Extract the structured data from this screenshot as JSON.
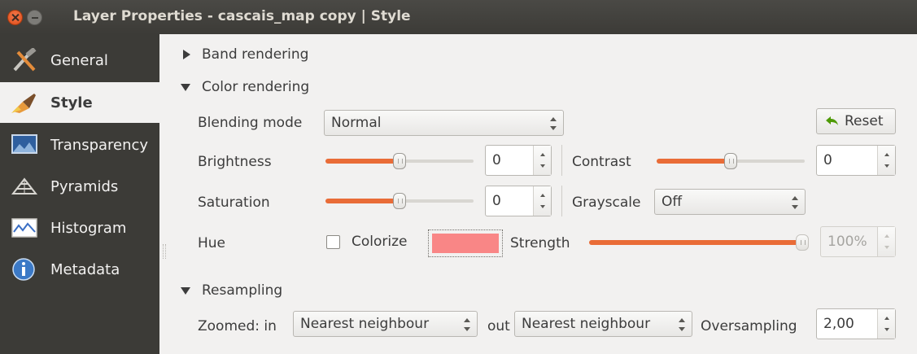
{
  "window": {
    "title": "Layer Properties - cascais_map copy | Style"
  },
  "sidebar": {
    "items": [
      {
        "label": "General",
        "icon": "general-tools-icon",
        "active": false
      },
      {
        "label": "Style",
        "icon": "style-brush-icon",
        "active": true
      },
      {
        "label": "Transparency",
        "icon": "transparency-icon",
        "active": false
      },
      {
        "label": "Pyramids",
        "icon": "pyramids-icon",
        "active": false
      },
      {
        "label": "Histogram",
        "icon": "histogram-icon",
        "active": false
      },
      {
        "label": "Metadata",
        "icon": "metadata-info-icon",
        "active": false
      }
    ]
  },
  "band_rendering": {
    "label": "Band rendering",
    "expanded": false
  },
  "color_rendering": {
    "label": "Color rendering",
    "expanded": true,
    "blending_mode": {
      "label": "Blending mode",
      "value": "Normal"
    },
    "reset_label": "Reset",
    "brightness": {
      "label": "Brightness",
      "value": "0",
      "slider_fraction": 0.5
    },
    "contrast": {
      "label": "Contrast",
      "value": "0",
      "slider_fraction": 0.5
    },
    "saturation": {
      "label": "Saturation",
      "value": "0",
      "slider_fraction": 0.5
    },
    "grayscale": {
      "label": "Grayscale",
      "value": "Off"
    },
    "hue": {
      "label": "Hue",
      "colorize_label": "Colorize",
      "colorize_checked": false,
      "color": "#f98686",
      "strength_label": "Strength",
      "strength_value": "100%",
      "strength_fraction": 1.0
    }
  },
  "resampling": {
    "label": "Resampling",
    "expanded": true,
    "zoomed_in_label": "Zoomed: in",
    "zoomed_in_value": "Nearest neighbour",
    "out_label": "out",
    "zoomed_out_value": "Nearest neighbour",
    "oversampling_label": "Oversampling",
    "oversampling_value": "2,00"
  },
  "colors": {
    "accent": "#e96c37",
    "sidebar_bg": "#3c3b37",
    "titlebar_bg": "#3c3b37"
  }
}
